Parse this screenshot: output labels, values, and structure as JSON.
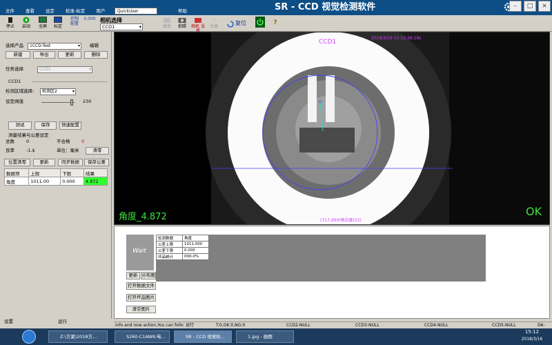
{
  "app": {
    "title": "SR - CCD 视觉检测软件"
  },
  "menu": {
    "items": [
      "文件",
      "查看",
      "设定",
      "校准-标定",
      "用户"
    ],
    "user": "QuickUser",
    "help": "帮助"
  },
  "toolbar": {
    "start": "启动",
    "stop": "停止",
    "zoom_full": "全屏",
    "calib": "标定",
    "control_label": "控制",
    "config_label": "配置",
    "config_value": "0.000",
    "camera_select_label": "相机选择",
    "camera_select_value": "CCD1",
    "trigger": "触发",
    "photo": "拍照",
    "camera_settings": "相机\n设置",
    "source": "光源",
    "reset": "复位",
    "help_icon": "?"
  },
  "left": {
    "select_product_label": "选择产品",
    "select_product_value": "1CCD-Test",
    "edit": "编辑",
    "new": "新建",
    "export": "导出",
    "update": "更新",
    "delete": "删除",
    "task_select_label": "任务选择",
    "task_select_value": "CCD1",
    "ccd_label": "CCD1",
    "region_label": "检测区域选择:",
    "region_value": "检测区2",
    "threshold_label": "设定阀值",
    "threshold_value": "230",
    "test": "测试",
    "save": "保存",
    "quick_config": "快速配置",
    "result_section": "测量结果与公差设定",
    "total_label": "总数",
    "total_value": "0",
    "ng_label": "不合格",
    "ng_value": "0",
    "yield_label": "良率",
    "yield_value": "-1.$",
    "unit_label": "单位：毫米",
    "clear": "清零",
    "pos_clear": "位置清零",
    "update2": "更新",
    "sync": "同步数据",
    "save_tol": "保存公差",
    "table": {
      "headers": [
        "数据项",
        "上限",
        "下限",
        "结果"
      ],
      "rows": [
        [
          "角度",
          "1011.00",
          "0.000",
          "4.872"
        ]
      ]
    },
    "tab_settings": "设置",
    "tab_run": "运行"
  },
  "view": {
    "ccd_label": "CCD1",
    "timestamp": "2018/3/16 15:12:36:18s",
    "angle_text": "角度_4.872",
    "grade_text": "(717,999)角白度(53)",
    "ok_text": "OK"
  },
  "bottom": {
    "wait": "Wait",
    "mini_table": [
      [
        "检测数据",
        "角度"
      ],
      [
        "公差上限",
        "1011.000"
      ],
      [
        "公差下限",
        "0.000"
      ],
      [
        "环品统计",
        "000-0%"
      ]
    ],
    "update": "更新",
    "chart": "分布图",
    "open_data": "打开数据文件",
    "open_ng": "打开坏品图片",
    "clear_img": "清空图片"
  },
  "status": {
    "message": "info and now action,You can follo",
    "run": "运行",
    "counts": "T:0,OK:0,NG:0",
    "ccd2": "CCD2-NULL",
    "ccd3": "CCD3-NULL",
    "ccd4": "CCD4-NULL",
    "ccd5": "CCD5-NULL",
    "ccd6": "D6-NUL"
  },
  "taskbar": {
    "tasks": [
      "Z:\\方案\\2018方...",
      "S260-C1AWK-电...",
      "SR - CCD 视觉检...",
      "1.jpg - 画图"
    ],
    "time": "15:12",
    "date": "2018/3/16"
  },
  "colors": {
    "title_bar": "#0e4e86",
    "result_green": "#33ff33",
    "ok_green": "#39e639",
    "overlay_blue": "#4040ff",
    "overlay_magenta": "#d040ff"
  }
}
